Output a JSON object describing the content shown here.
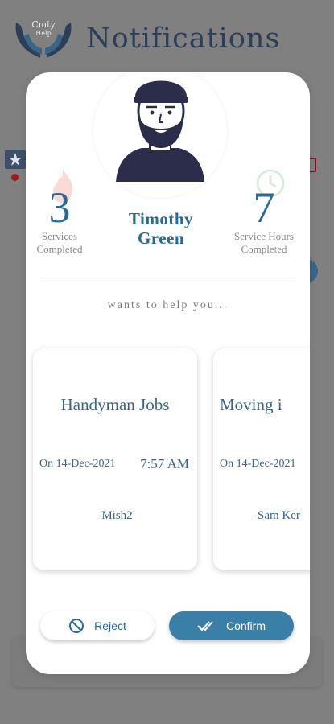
{
  "header": {
    "title": "Notifications",
    "logo_text": "Cmty Help"
  },
  "provider": {
    "name": "Timothy Green",
    "services_completed": {
      "value": "3",
      "label": "Services Completed"
    },
    "service_hours": {
      "value": "7",
      "label": "Service Hours Completed"
    }
  },
  "message": "wants to help you...",
  "cards": [
    {
      "title": "Handyman Jobs",
      "date": "On 14-Dec-2021",
      "time": "7:57 AM",
      "user": "-Mish2"
    },
    {
      "title": "Moving i",
      "date": "On 14-Dec-2021",
      "time": "",
      "user": "-Sam Ker"
    }
  ],
  "actions": {
    "reject": "Reject",
    "confirm": "Confirm"
  },
  "colors": {
    "accent": "#3a7fa8",
    "title": "#2c3f59",
    "overlay": "#808080"
  }
}
